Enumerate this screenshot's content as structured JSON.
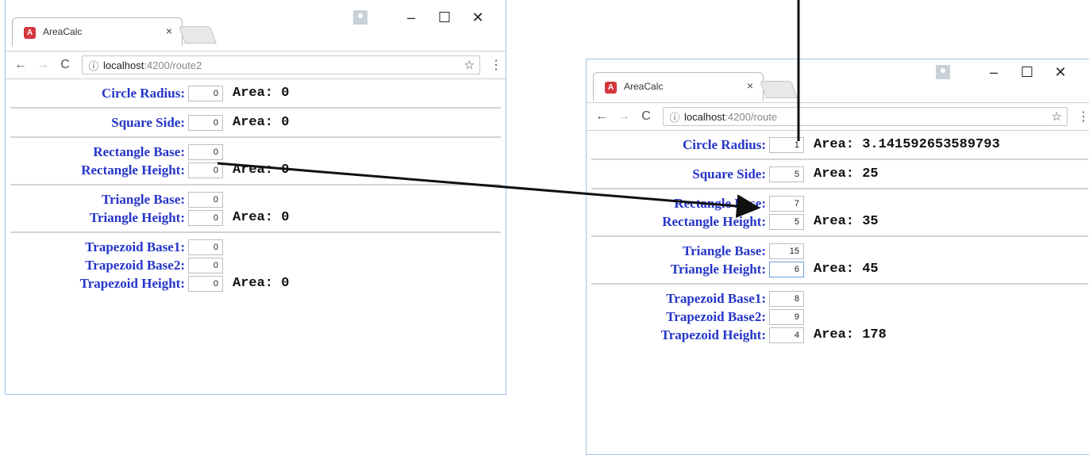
{
  "browser": {
    "tab_title": "AreaCalc",
    "tab_close": "×",
    "favicon_letter": "A",
    "url_host": "localhost",
    "url_path": ":4200/route2",
    "window_controls": {
      "minimize": "–",
      "maximize": "☐",
      "close": "✕"
    },
    "nav": {
      "back": "←",
      "forward": "→",
      "reload": "C",
      "info": "ⓘ",
      "star": "☆",
      "menu": "⋮"
    }
  },
  "win1": {
    "circle": {
      "label": "Circle Radius:",
      "value": "0",
      "area_label": "Area:",
      "area": "0"
    },
    "square": {
      "label": "Square Side:",
      "value": "0",
      "area_label": "Area:",
      "area": "0"
    },
    "rectangle": {
      "base_label": "Rectangle Base:",
      "base": "0",
      "height_label": "Rectangle Height:",
      "height": "0",
      "area_label": "Area:",
      "area": "0"
    },
    "triangle": {
      "base_label": "Triangle Base:",
      "base": "0",
      "height_label": "Triangle Height:",
      "height": "0",
      "area_label": "Area:",
      "area": "0"
    },
    "trapezoid": {
      "base1_label": "Trapezoid Base1:",
      "base1": "0",
      "base2_label": "Trapezoid Base2:",
      "base2": "0",
      "height_label": "Trapezoid Height:",
      "height": "0",
      "area_label": "Area:",
      "area": "0"
    }
  },
  "win2": {
    "url_path": ":4200/route",
    "circle": {
      "label": "Circle Radius:",
      "value": "1",
      "area_label": "Area:",
      "area": "3.141592653589793"
    },
    "square": {
      "label": "Square Side:",
      "value": "5",
      "area_label": "Area:",
      "area": "25"
    },
    "rectangle": {
      "base_label": "Rectangle Base:",
      "base": "7",
      "height_label": "Rectangle Height:",
      "height": "5",
      "area_label": "Area:",
      "area": "35"
    },
    "triangle": {
      "base_label": "Triangle Base:",
      "base": "15",
      "height_label": "Triangle Height:",
      "height": "6",
      "area_label": "Area:",
      "area": "45"
    },
    "trapezoid": {
      "base1_label": "Trapezoid Base1:",
      "base1": "8",
      "base2_label": "Trapezoid Base2:",
      "base2": "9",
      "height_label": "Trapezoid Height:",
      "height": "4",
      "area_label": "Area:",
      "area": "178"
    }
  }
}
